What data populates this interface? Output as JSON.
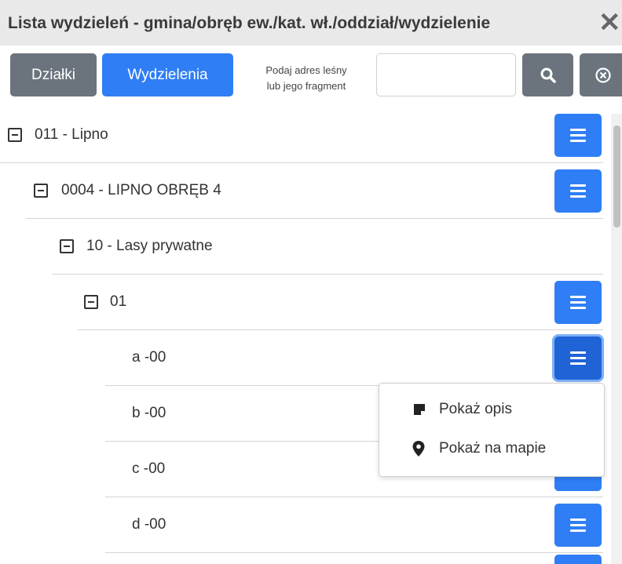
{
  "window": {
    "title": "Lista wydzieleń - gmina/obręb ew./kat. wł./oddział/wydzielenie",
    "close_symbol": "✕"
  },
  "toolbar": {
    "dzialki_label": "Działki",
    "wydzielenia_label": "Wydzielenia",
    "hint_line1": "Podaj adres leśny",
    "hint_line2": "lub jego fragment",
    "search_value": "",
    "search_icon": "search-icon",
    "clear_icon": "clear-circle-icon"
  },
  "tree": [
    {
      "label": "011 - Lipno",
      "level": 0,
      "expanded": true,
      "has_menu": true
    },
    {
      "label": "0004 - LIPNO OBRĘB 4",
      "level": 1,
      "expanded": true,
      "has_menu": true
    },
    {
      "label": "10 - Lasy prywatne",
      "level": 2,
      "expanded": true,
      "has_menu": false
    },
    {
      "label": "01",
      "level": 3,
      "expanded": true,
      "has_menu": true
    },
    {
      "label": "a -00",
      "level": 4,
      "has_menu": true,
      "menu_open": true
    },
    {
      "label": "b -00",
      "level": 4,
      "has_menu": true
    },
    {
      "label": "c -00",
      "level": 4,
      "has_menu": true
    },
    {
      "label": "d -00",
      "level": 4,
      "has_menu": true
    }
  ],
  "dropdown": {
    "items": [
      {
        "label": "Pokaż opis",
        "icon": "note-icon"
      },
      {
        "label": "Pokaż na mapie",
        "icon": "map-marker-icon"
      }
    ]
  },
  "colors": {
    "primary": "#2f7ef5",
    "secondary": "#6b747d",
    "header_bg": "#e9e9e9"
  }
}
